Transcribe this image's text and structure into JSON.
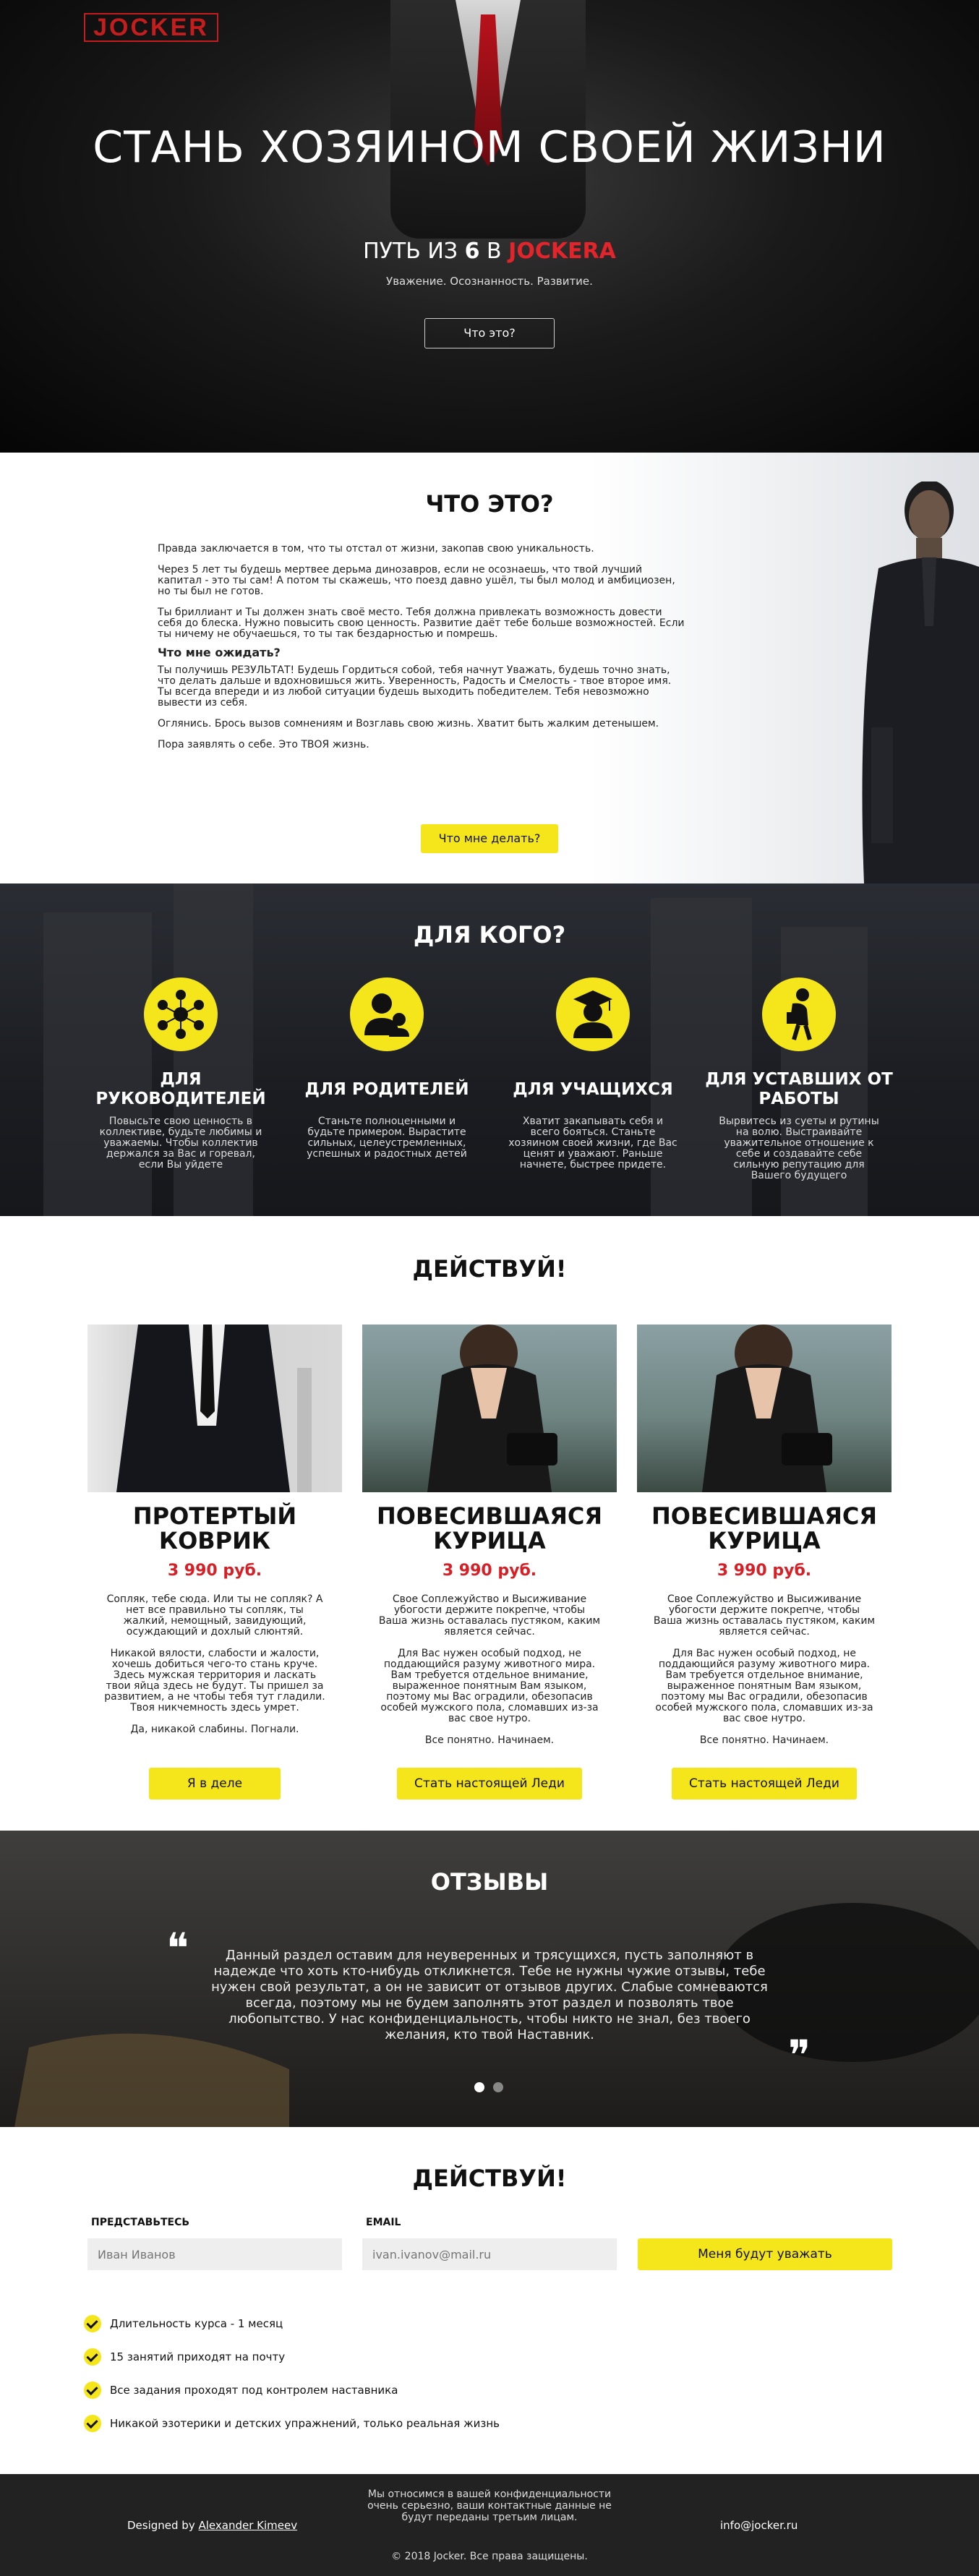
{
  "header": {
    "logo": "JOCKER"
  },
  "hero": {
    "title": "СТАНЬ ХОЗЯИНОМ СВОЕЙ ЖИЗНИ",
    "subtitle_pre": "ПУТЬ ИЗ",
    "subtitle_num": "6",
    "subtitle_mid": "В",
    "subtitle_brand": "JOCKERA",
    "tagline": "Уважение. Осознанность. Развитие.",
    "button": "Что это?"
  },
  "about": {
    "title": "ЧТО ЭТО?",
    "p1": "Правда заключается в том, что ты отстал от жизни, закопав свою уникальность.",
    "p2": "Через 5 лет ты будешь мертвее дерьма динозавров, если не осознаешь, что твой лучший капитал - это ты сам! А потом ты скажешь, что поезд давно ушёл, ты был молод и амбициозен, но ты был не готов.",
    "p3": "Ты бриллиант и Ты должен знать своё место. Тебя должна привлекать возможность довести себя до блеска. Нужно повысить свою ценность. Развитие даёт тебе больше возможностей. Если ты ничему не обучаешься, то ты так бездарностью и помрешь.",
    "subtitle": "Что мне ожидать?",
    "p4": "Ты получишь РЕЗУЛЬТАТ! Будешь Гордиться собой, тебя начнут Уважать, будешь точно знать, что делать дальше и вдохновишься жить. Уверенность, Радость и Смелость - твое второе имя. Ты всегда впереди и из любой ситуации будешь выходить победителем. Тебя невозможно вывести из себя.",
    "p5": "Оглянись. Брось вызов сомнениям и Возглавь свою жизнь. Хватит быть жалким детенышем.",
    "p6": "Пора заявлять о себе. Это ТВОЯ жизнь.",
    "button": "Что мне делать?"
  },
  "audience": {
    "title": "ДЛЯ КОГО?",
    "items": [
      {
        "icon": "network-people-icon",
        "title": "ДЛЯ РУКОВОДИТЕЛЕЙ",
        "text": "Повысьте свою ценность в коллективе, будьте любимы и уважаемы. Чтобы коллектив держался за Вас и горевал, если Вы уйдете"
      },
      {
        "icon": "parent-child-icon",
        "title": "ДЛЯ РОДИТЕЛЕЙ",
        "text": "Станьте полноценными и будьте примером. Вырастите сильных, целеустремленных, успешных и радостных детей"
      },
      {
        "icon": "graduate-icon",
        "title": "ДЛЯ УЧАЩИХСЯ",
        "text": "Хватит закапывать себя и всего бояться. Станьте хозяином своей жизни, где Вас ценят и уважают. Раньше начнете, быстрее придете."
      },
      {
        "icon": "tired-worker-icon",
        "title": "ДЛЯ УСТАВШИХ ОТ РАБОТЫ",
        "text": "Вырвитесь из суеты и рутины на волю. Выстраивайте уважительное отношение к себе и создавайте себе сильную репутацию для Вашего будущего"
      }
    ]
  },
  "products": {
    "title": "ДЕЙСТВУЙ!",
    "items": [
      {
        "title": "ПРОТЕРТЫЙ КОВРИК",
        "price": "3 990 руб.",
        "p1": "Сопляк, тебе сюда. Или ты не сопляк? А нет все правильно ты сопляк, ты жалкий, немощный, завидующий, осуждающий и дохлый слюнтяй.",
        "p2": "Никакой вялости, слабости и жалости, хочешь добиться чего-то стань круче. Здесь мужская территория и ласкать твои яйца здесь не будут. Ты пришел за развитием, а не чтобы тебя тут гладили. Твоя никчемность здесь умрет.",
        "p3": "Да, никакой слабины. Погнали.",
        "button": "Я в деле"
      },
      {
        "title": "ПОВЕСИВШАЯСЯ КУРИЦА",
        "price": "3 990 руб.",
        "p1": "Свое Соплежуйство и Высиживание убогости держите покрепче, чтобы Ваша жизнь оставалась пустяком, каким является сейчас.",
        "p2": "Для Вас нужен особый подход, не поддающийся разуму животного мира. Вам требуется отдельное внимание, выраженное понятным Вам языком, поэтому мы Вас оградили, обезопасив особей мужского пола, сломавших из-за вас свое нутро.",
        "p3": "Все понятно. Начинаем.",
        "button": "Стать настоящей Леди"
      },
      {
        "title": "ПОВЕСИВШАЯСЯ КУРИЦА",
        "price": "3 990 руб.",
        "p1": "Свое Соплежуйство и Высиживание убогости держите покрепче, чтобы Ваша жизнь оставалась пустяком, каким является сейчас.",
        "p2": "Для Вас нужен особый подход, не поддающийся разуму животного мира. Вам требуется отдельное внимание, выраженное понятным Вам языком, поэтому мы Вас оградили, обезопасив особей мужского пола, сломавших из-за вас свое нутро.",
        "p3": "Все понятно. Начинаем.",
        "button": "Стать настоящей Леди"
      }
    ]
  },
  "reviews": {
    "title": "ОТЗЫВЫ",
    "text": "Данный раздел оставим для неуверенных и трясущихся, пусть заполняют в надежде что хоть кто-нибудь откликнется. Тебе не нужны чужие отзывы, тебе нужен свой результат, а он не зависит от отзывов других. Слабые сомневаются всегда, поэтому мы не будем заполнять этот раздел и позволять твое любопытство. У нас конфиденциальность, чтобы никто не знал, без твоего желания, кто твой Наставник.",
    "open_quote": "❝",
    "close_quote": "❞"
  },
  "signup": {
    "title": "ДЕЙСТВУЙ!",
    "name_label": "ПРЕДСТАВЬТЕСЬ",
    "name_placeholder": "Иван Иванов",
    "email_label": "EMAIL",
    "email_placeholder": "ivan.ivanov@mail.ru",
    "submit": "Меня будут уважать",
    "features": [
      "Длительность курса - 1 месяц",
      "15 занятий приходят на почту",
      "Все задания проходят под контролем наставника",
      "Никакой эзотерики и детских упражнений, только реальная жизнь"
    ]
  },
  "footer": {
    "designed_by": "Designed by",
    "designer": "Alexander Kimeev",
    "privacy": "Мы относимся в вашей конфиденциальности очень серьезно, ваши контактные данные не будут переданы третьим лицам.",
    "email": "info@jocker.ru",
    "copyright": "© 2018 Jocker. Все права защищены."
  },
  "colors": {
    "accent": "#f5e61b",
    "brand_red": "#e3242b",
    "dark": "#222222"
  }
}
